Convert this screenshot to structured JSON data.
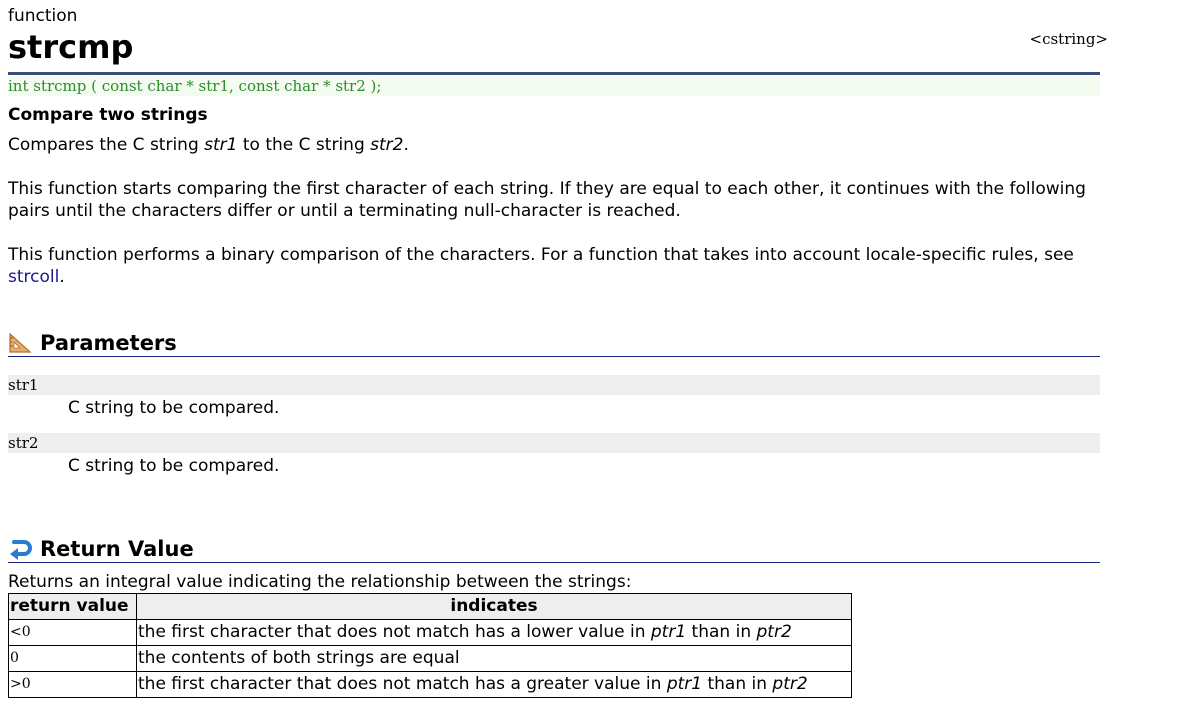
{
  "header": {
    "kind": "function",
    "title": "strcmp",
    "header_link": "<cstring>"
  },
  "prototype": "int strcmp ( const char * str1, const char * str2 );",
  "summary": "Compare two strings",
  "paragraphs": {
    "p1_a": "Compares the C string ",
    "p1_str1": "str1",
    "p1_b": " to the C string ",
    "p1_str2": "str2",
    "p1_c": ".",
    "p2": "This function starts comparing the first character of each string. If they are equal to each other, it continues with the following pairs until the characters differ or until a terminating null-character is reached.",
    "p3_a": "This function performs a binary comparison of the characters. For a function that takes into account locale-specific rules, see ",
    "p3_link": "strcoll",
    "p3_b": "."
  },
  "parameters": {
    "heading": "Parameters",
    "icon": "ruler-triangle-icon",
    "items": [
      {
        "name": "str1",
        "desc": "C string to be compared."
      },
      {
        "name": "str2",
        "desc": "C string to be compared."
      }
    ]
  },
  "return_value": {
    "heading": "Return Value",
    "icon": "return-arrow-icon",
    "intro": "Returns an integral value indicating the relationship between the strings:",
    "table": {
      "headers": [
        "return value",
        "indicates"
      ],
      "rows": [
        {
          "value": "<0",
          "a": "the first character that does not match has a lower value in ",
          "p1": "ptr1",
          "b": " than in ",
          "p2": "ptr2",
          "c": ""
        },
        {
          "value": "0",
          "a": "the contents of both strings are equal",
          "p1": "",
          "b": "",
          "p2": "",
          "c": ""
        },
        {
          "value": ">0",
          "a": "the first character that does not match has a greater value in ",
          "p1": "ptr1",
          "b": " than in ",
          "p2": "ptr2",
          "c": ""
        }
      ]
    }
  },
  "colors": {
    "title_rule": "#3a4a7a",
    "prototype_text": "#2e8b2e",
    "prototype_bg": "#f4fbf0",
    "link": "#1a1a8a",
    "section_rule": "#1a237e",
    "param_bg": "#eeeeee"
  }
}
